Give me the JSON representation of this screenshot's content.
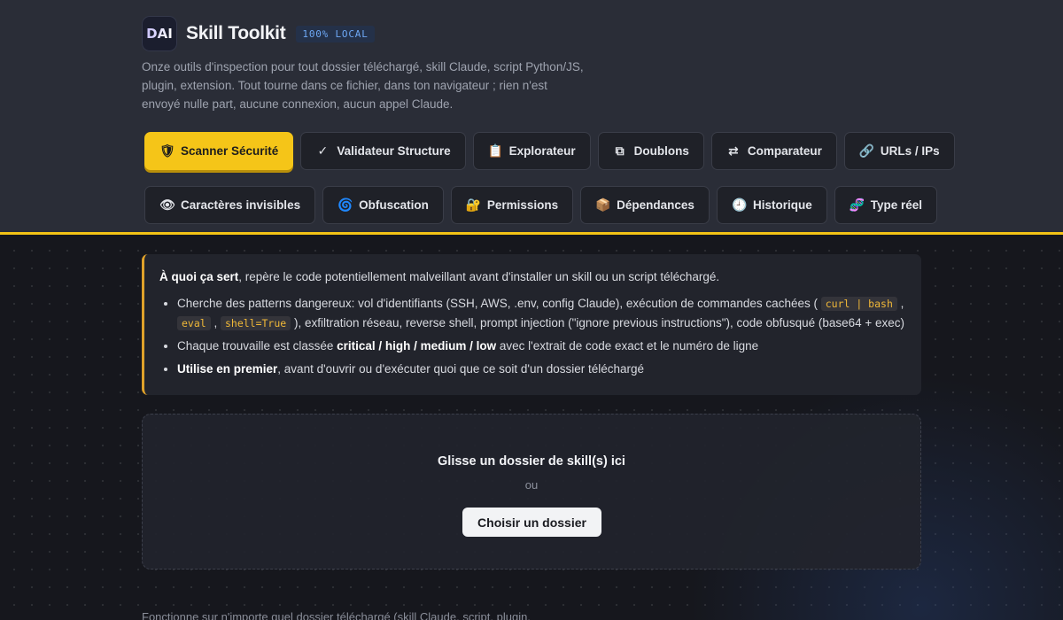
{
  "header": {
    "logo_text": "DAI",
    "title": "Skill Toolkit",
    "badge": "100% LOCAL",
    "description": "Onze outils d'inspection pour tout dossier téléchargé, skill Claude, script Python/JS, plugin, extension. Tout tourne dans ce fichier, dans ton navigateur ; rien n'est envoyé nulle part, aucune connexion, aucun appel Claude."
  },
  "tabs_row1": [
    {
      "icon": "shield-icon",
      "glyph": "🛡",
      "label": "Scanner Sécurité",
      "active": true
    },
    {
      "icon": "check-icon",
      "glyph": "✓",
      "label": "Validateur Structure"
    },
    {
      "icon": "clipboard-icon",
      "glyph": "📋",
      "label": "Explorateur"
    },
    {
      "icon": "duplicate-icon",
      "glyph": "⧉",
      "label": "Doublons"
    },
    {
      "icon": "swap-icon",
      "glyph": "⇄",
      "label": "Comparateur"
    },
    {
      "icon": "link-icon",
      "glyph": "🔗",
      "label": "URLs / IPs"
    }
  ],
  "tabs_row2": [
    {
      "icon": "eye-icon",
      "glyph": "👁",
      "label": "Caractères invisibles"
    },
    {
      "icon": "spiral-icon",
      "glyph": "🌀",
      "label": "Obfuscation"
    },
    {
      "icon": "lock-icon",
      "glyph": "🔐",
      "label": "Permissions"
    },
    {
      "icon": "package-icon",
      "glyph": "📦",
      "label": "Dépendances"
    },
    {
      "icon": "clock-icon",
      "glyph": "🕘",
      "label": "Historique"
    },
    {
      "icon": "dna-icon",
      "glyph": "🧬",
      "label": "Type réel"
    }
  ],
  "info": {
    "lead_bold": "À quoi ça sert",
    "lead_rest": ", repère le code potentiellement malveillant avant d'installer un skill ou un script téléchargé.",
    "b1_a": "Cherche des patterns dangereux: vol d'identifiants (SSH, AWS, .env, config Claude), exécution de commandes cachées ( ",
    "b1_code1": "curl | bash",
    "b1_sep1": " , ",
    "b1_code2": "eval",
    "b1_sep2": " , ",
    "b1_code3": "shell=True",
    "b1_b": " ), exfiltration réseau, reverse shell, prompt injection (\"ignore previous instructions\"), code obfusqué (base64 + exec)",
    "b2_a": "Chaque trouvaille est classée ",
    "b2_bold": "critical / high / medium / low",
    "b2_b": " avec l'extrait de code exact et le numéro de ligne",
    "b3_bold": "Utilise en premier",
    "b3_b": ", avant d'ouvrir ou d'exécuter quoi que ce soit d'un dossier téléchargé"
  },
  "drop": {
    "title": "Glisse un dossier de skill(s) ici",
    "or": "ou",
    "button": "Choisir un dossier"
  },
  "footer": "Fonctionne sur n'importe quel dossier téléchargé (skill Claude, script, plugin,"
}
